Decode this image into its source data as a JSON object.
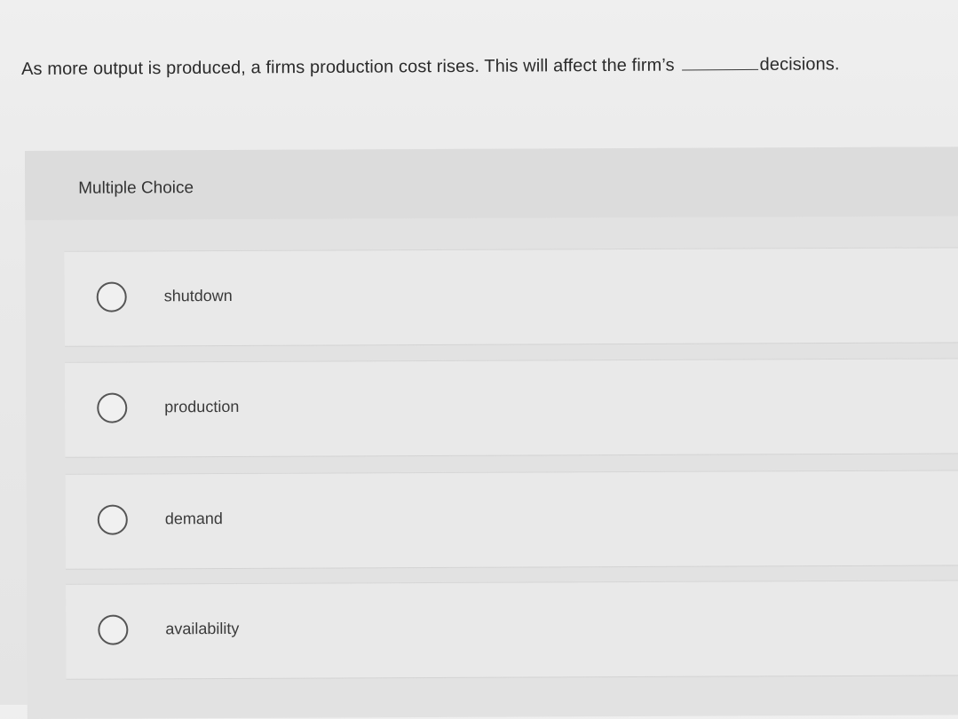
{
  "question": {
    "text_before": "As more output is produced, a firms production cost rises. This will affect the firm’s",
    "text_after": "decisions."
  },
  "panel": {
    "label": "Multiple Choice"
  },
  "options": [
    {
      "label": "shutdown",
      "selected": false
    },
    {
      "label": "production",
      "selected": false
    },
    {
      "label": "demand",
      "selected": false
    },
    {
      "label": "availability",
      "selected": false
    }
  ]
}
